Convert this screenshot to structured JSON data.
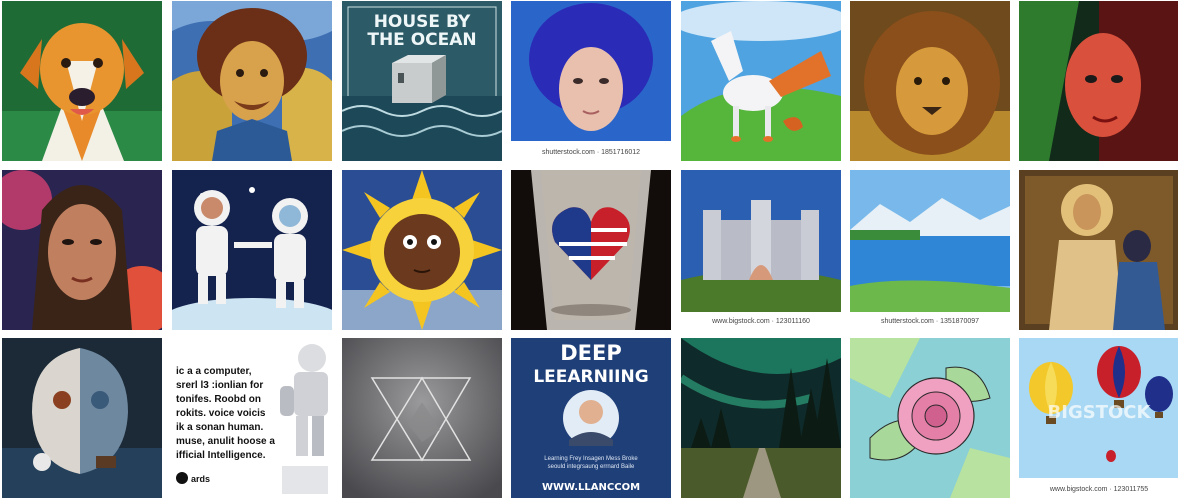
{
  "tiles": {
    "house": {
      "line1": "HOUSE BY",
      "line2": "THE OCEAN"
    },
    "deep": {
      "line1": "DEEP",
      "line2": "LEEARNIING",
      "body1": "Learning Frey Insagen Mess Broke",
      "body2": "seould integrsaung errnard Baile",
      "footer": "WWW.LLANCCOM"
    },
    "computer": {
      "lines": [
        "ic a a computer,",
        "srerl l3 :ionlian for",
        "tonifes. Roobd on",
        "rokits. voice voicis",
        "ik a sonan human.",
        "muse, anulit hoose a",
        "ifficial Intelligence."
      ],
      "logo": "ards"
    },
    "watermarks": {
      "woman": "shutterstock.com · 1851716012",
      "castle": "www.bigstock.com · 123011160",
      "lake": "shutterstock.com · 1351870097",
      "balloons_center": "BIGSTOCK",
      "balloons_footer": "www.bigstock.com · 123011755"
    }
  }
}
